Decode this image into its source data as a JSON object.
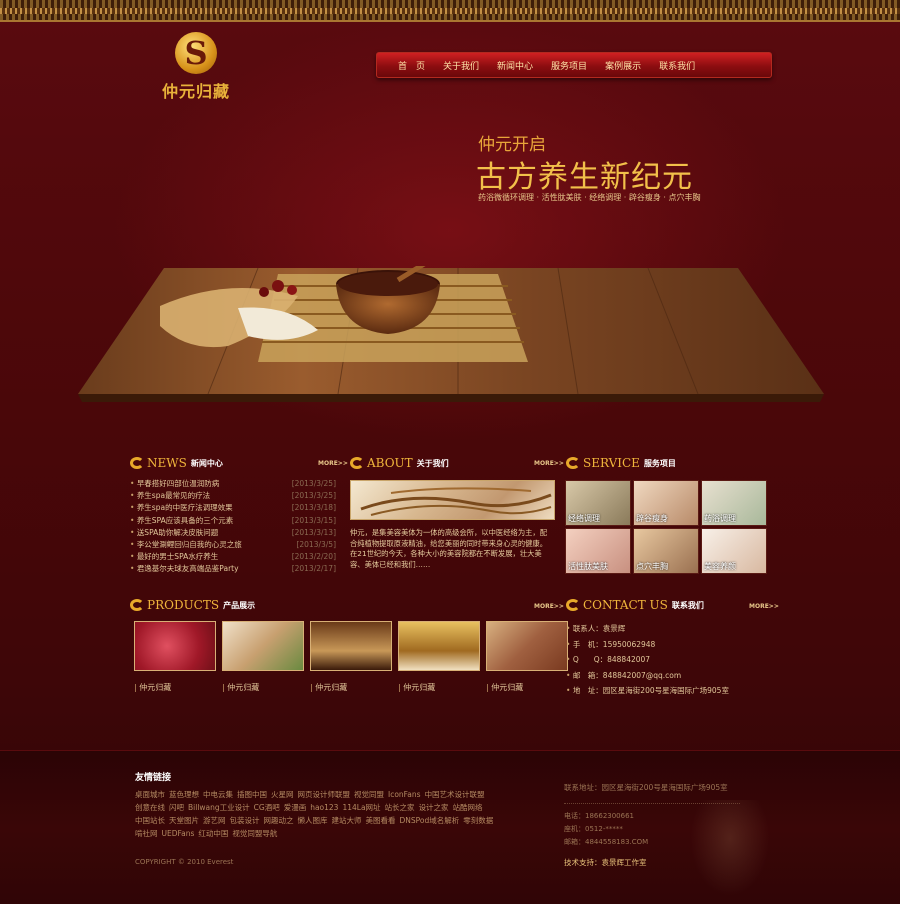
{
  "logo": {
    "text": "仲元归藏",
    "mark": "S"
  },
  "nav": [
    "首　页",
    "关于我们",
    "新闻中心",
    "服务项目",
    "案例展示",
    "联系我们"
  ],
  "hero": {
    "subtitle": "仲元开启",
    "title": "古方养生新纪元",
    "tags": "药浴微循环调理 · 活性肽美肤 · 经络调理 · 辟谷瘦身 · 点穴丰胸"
  },
  "news": {
    "en": "NEWS",
    "cn": "新闻中心",
    "more": "MORE>>",
    "items": [
      {
        "title": "早春搭好四部位温润防病",
        "date": "[2013/3/25]"
      },
      {
        "title": "养生spa最常见的疗法",
        "date": "[2013/3/25]"
      },
      {
        "title": "养生spa的中医疗法调理效果",
        "date": "[2013/3/18]"
      },
      {
        "title": "养生SPA应该具备的三个元素",
        "date": "[2013/3/15]"
      },
      {
        "title": "送SPA助你解决皮肤问题",
        "date": "[2013/3/13]"
      },
      {
        "title": "李公堂涮鲤回归自我的心灵之旅",
        "date": "[2013/3/5]"
      },
      {
        "title": "最好的男士SPA水疗养生",
        "date": "[2013/2/20]"
      },
      {
        "title": "君逸基尔夫球友高端品鉴Party",
        "date": "[2013/2/17]"
      }
    ]
  },
  "about": {
    "en": "ABOUT",
    "cn": "关于我们",
    "more": "MORE>>",
    "text": "仲元，是集美容美体为一体的高级会所，以中医经络为主，配合纯植物提取原液精油，给您美丽的同时带来身心灵的健康。在21世纪的今天，各种大小的美容院都在不断发展，壮大美容、美体已经和我们……"
  },
  "service": {
    "en": "SERVICE",
    "cn": "服务项目",
    "items": [
      "经络调理",
      "辟谷瘦身",
      "药浴调理",
      "活性肽美肤",
      "点穴丰胸",
      "美容养颜"
    ]
  },
  "products": {
    "en": "PRODUCTS",
    "cn": "产品展示",
    "more": "MORE>>",
    "items": [
      "仲元归藏",
      "仲元归藏",
      "仲元归藏",
      "仲元归藏",
      "仲元归藏"
    ]
  },
  "contact": {
    "en": "CONTACT US",
    "cn": "联系我们",
    "more": "MORE>>",
    "items": [
      "联系人：袁景辉",
      "手　机：15950062948",
      "Q　　Q：848842007",
      "邮　箱：848842007@qq.com",
      "地　址：园区星海街200号星海国际广场905室"
    ]
  },
  "footer": {
    "links_title": "友情链接",
    "links": [
      "桌面城市",
      "蓝色理想",
      "中电云集",
      "插图中国",
      "火星网",
      "网页设计师联盟",
      "视觉同盟",
      "IconFans",
      "中国艺术设计联盟",
      "创意在线",
      "闪吧",
      "Billwang工业设计",
      "CG酒吧",
      "爱漫画",
      "hao123",
      "114La网址",
      "站长之家",
      "设计之家",
      "站酷网络",
      "中国站长",
      "天堂图片",
      "游艺网",
      "包装设计",
      "网趣动之",
      "懒人图库",
      "建站大师",
      "美图看看",
      "DNSPod域名解析",
      "零刻数据",
      "啃社网",
      "UEDFans",
      "红动中国",
      "视觉同盟导航"
    ],
    "copyright": "COPYRIGHT © 2010 Everest",
    "address": "联系地址：园区星海街200号星海国际广场905室",
    "phone": "电话：18662300661",
    "fax": "座机：0512-*****",
    "email": "邮箱：4844558183.COM",
    "support": "技术支持：袁景辉工作室"
  }
}
